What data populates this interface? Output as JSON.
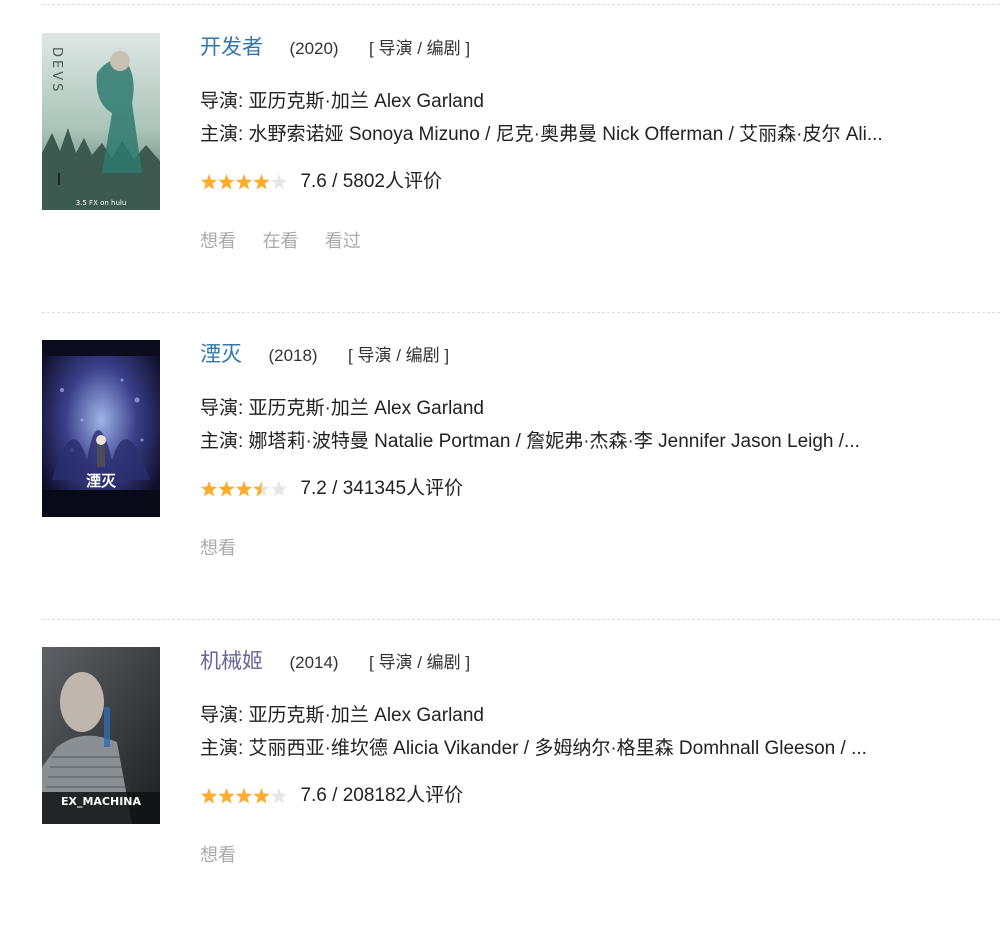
{
  "colors": {
    "link": "#3377aa",
    "visited_link": "#666699",
    "star_on": "#ffac2d",
    "star_off": "#e6e6e6",
    "action": "#aaaaaa",
    "divider": "#dddddd"
  },
  "items": [
    {
      "title": "开发者",
      "year": "(2020)",
      "roles": "[ 导演 / 编剧 ]",
      "director": "导演: 亚历克斯·加兰 Alex Garland",
      "cast": "主演: 水野索诺娅 Sonoya Mizuno / 尼克·奥弗曼 Nick Offerman / 艾丽森·皮尔 Ali...",
      "star_rating": 4,
      "rating_text": "7.6 / 5802人评价",
      "poster": {
        "icon": "devs-poster",
        "lettering": "DEVS",
        "footer": "3.5 FX on hulu"
      },
      "actions": [
        "想看",
        "在看",
        "看过"
      ]
    },
    {
      "title": "湮灭",
      "year": "(2018)",
      "roles": "[ 导演 / 编剧 ]",
      "director": "导演: 亚历克斯·加兰 Alex Garland",
      "cast": "主演: 娜塔莉·波特曼 Natalie Portman / 詹妮弗·杰森·李 Jennifer Jason Leigh /...",
      "star_rating": 3.5,
      "rating_text": "7.2 / 341345人评价",
      "poster": {
        "icon": "annihilation-poster",
        "lettering": "湮灭"
      },
      "actions": [
        "想看"
      ]
    },
    {
      "title": "机械姬",
      "year": "(2014)",
      "roles": "[ 导演 / 编剧 ]",
      "director": "导演: 亚历克斯·加兰 Alex Garland",
      "cast": "主演: 艾丽西亚·维坎德 Alicia Vikander / 多姆纳尔·格里森 Domhnall Gleeson / ...",
      "star_rating": 4,
      "rating_text": "7.6 / 208182人评价",
      "poster": {
        "icon": "ex-machina-poster",
        "lettering": "EX_MACHINA"
      },
      "actions": [
        "想看"
      ]
    }
  ]
}
